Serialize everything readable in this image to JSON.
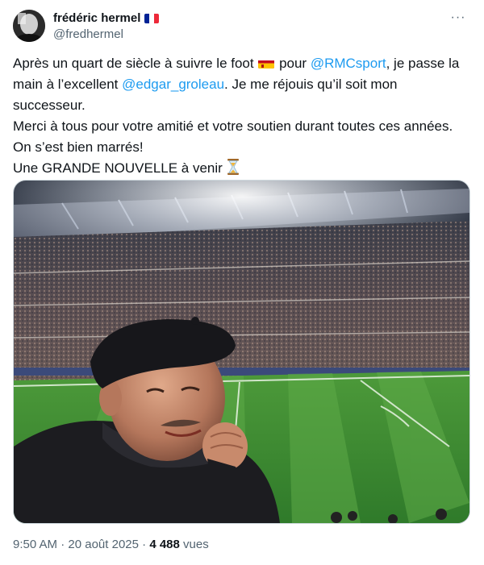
{
  "author": {
    "display_name": "frédéric hermel",
    "handle": "@fredhermel",
    "flag_colors": [
      "#002395",
      "#ffffff",
      "#ed2939"
    ]
  },
  "more_menu": "···",
  "tweet": {
    "line1_a": "Après un quart de siècle à suivre le foot ",
    "line1_b": " pour ",
    "mention_rmc": "@RMCsport",
    "line1_c": ", je passe la main à l’excellent ",
    "mention_edgar": "@edgar_groleau",
    "line1_d": ". Je me réjouis qu’il soit mon successeur.",
    "line2": "Merci à tous pour votre amitié et votre soutien durant toutes ces années.",
    "line3": "On s’est bien marrés!",
    "line4": "Une GRANDE NOUVELLE à venir ",
    "mention_color": "#1d9bf0"
  },
  "media": {
    "description_icon": "stadium-selfie-photo"
  },
  "meta": {
    "time": "9:50 AM",
    "separator": " · ",
    "date": "20 août 2025",
    "separator2": " · ",
    "views_count": "4 488",
    "views_label": " vues"
  }
}
